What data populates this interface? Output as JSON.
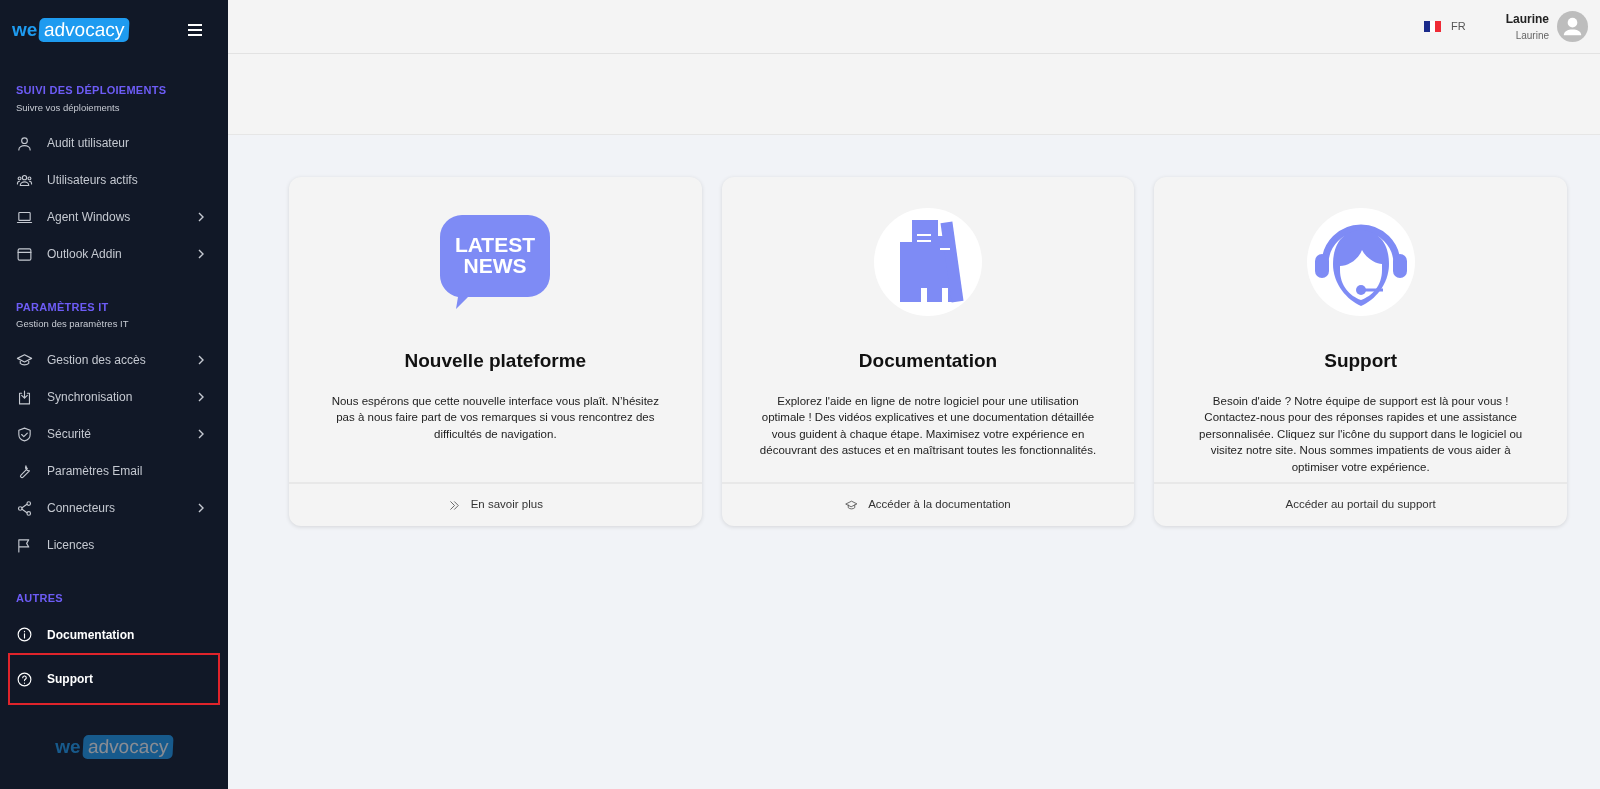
{
  "sidebar": {
    "logo": {
      "prefix": "we",
      "word": "advocacy"
    },
    "sections": [
      {
        "title": "SUIVI DES DÉPLOIEMENTS",
        "subtitle": "Suivre vos déploiements",
        "items": [
          {
            "label": "Audit utilisateur",
            "has_submenu": false,
            "emphasized": false,
            "highlighted": false
          },
          {
            "label": "Utilisateurs actifs",
            "has_submenu": false,
            "emphasized": false,
            "highlighted": false
          },
          {
            "label": "Agent Windows",
            "has_submenu": true,
            "emphasized": false,
            "highlighted": false
          },
          {
            "label": "Outlook Addin",
            "has_submenu": true,
            "emphasized": false,
            "highlighted": false
          }
        ]
      },
      {
        "title": "PARAMÈTRES IT",
        "subtitle": "Gestion des paramètres IT",
        "items": [
          {
            "label": "Gestion des accès",
            "has_submenu": true,
            "emphasized": false,
            "highlighted": false
          },
          {
            "label": "Synchronisation",
            "has_submenu": true,
            "emphasized": false,
            "highlighted": false
          },
          {
            "label": "Sécurité",
            "has_submenu": true,
            "emphasized": false,
            "highlighted": false
          },
          {
            "label": "Paramètres Email",
            "has_submenu": false,
            "emphasized": false,
            "highlighted": false
          },
          {
            "label": "Connecteurs",
            "has_submenu": true,
            "emphasized": false,
            "highlighted": false
          },
          {
            "label": "Licences",
            "has_submenu": false,
            "emphasized": false,
            "highlighted": false
          }
        ]
      },
      {
        "title": "AUTRES",
        "items": [
          {
            "label": "Documentation",
            "has_submenu": false,
            "emphasized": true,
            "highlighted": false
          },
          {
            "label": "Support",
            "has_submenu": false,
            "emphasized": true,
            "highlighted": true
          }
        ]
      }
    ],
    "footer_logo": {
      "prefix": "we",
      "word": "advocacy"
    }
  },
  "header": {
    "language": "FR",
    "user": {
      "name": "Laurine",
      "subtitle": "Laurine"
    }
  },
  "cards": [
    {
      "image_text": [
        "LATEST",
        "NEWS"
      ],
      "title": "Nouvelle plateforme",
      "text": "Nous espérons que cette nouvelle interface vous plaît. N’hésitez pas à nous faire part de vos remarques si vous rencontrez des difficultés de navigation.",
      "link": "En savoir plus"
    },
    {
      "title": "Documentation",
      "text": "Explorez l'aide en ligne de notre logiciel pour une utilisation optimale ! Des vidéos explicatives et une documentation détaillée vous guident à chaque étape. Maximisez votre expérience en découvrant des astuces et en maîtrisant toutes les fonctionnalités.",
      "link": "Accéder à la documentation"
    },
    {
      "title": "Support",
      "text": "Besoin d'aide ? Notre équipe de support est là pour vous ! Contactez-nous pour des réponses rapides et une assistance personnalisée. Cliquez sur l'icône du support dans le logiciel ou visitez notre site. Nous sommes impatients de vous aider à optimiser votre expérience.",
      "link": "Accéder au portail du support"
    }
  ]
}
